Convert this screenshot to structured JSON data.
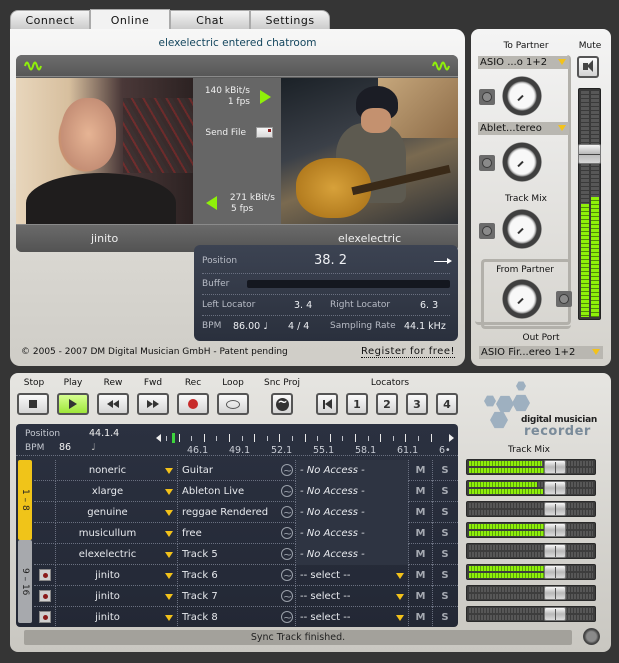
{
  "tabs": [
    {
      "label": "Connect",
      "active": false
    },
    {
      "label": "Online",
      "active": true
    },
    {
      "label": "Chat",
      "active": false
    },
    {
      "label": "Settings",
      "active": false
    }
  ],
  "online": {
    "chat_status": "elexelectric entered chatroom",
    "video": {
      "left_user": "jinito",
      "right_user": "elexelectric",
      "outgoing_rate": "140 kBit/s",
      "outgoing_fps": "1 fps",
      "send_file_label": "Send File",
      "incoming_rate": "271 kBit/s",
      "incoming_fps": "5 fps"
    },
    "status": {
      "position_label": "Position",
      "position_value": "38. 2",
      "buffer_label": "Buffer",
      "left_locator_label": "Left Locator",
      "left_locator_value": "3. 4",
      "right_locator_label": "Right Locator",
      "right_locator_value": "6. 3",
      "bpm_label": "BPM",
      "bpm_value": "86.00 ♩",
      "time_signature": "4 / 4",
      "sampling_rate_label": "Sampling Rate",
      "sampling_rate_value": "44.1 kHz"
    },
    "copyright": "© 2005 - 2007 DM Digital Musician GmbH - Patent pending",
    "register_link": "Register for free!"
  },
  "routing": {
    "to_partner_label": "To Partner",
    "mute_label": "Mute",
    "input1": "ASIO ...o 1+2",
    "input2": "Ablet...tereo",
    "track_mix_label": "Track Mix",
    "from_partner_label": "From Partner",
    "out_port_label": "Out Port",
    "out_port_value": "ASIO Fir...ereo 1+2",
    "master_level_left": 0.5,
    "master_level_right": 0.53,
    "master_fader": 0.74
  },
  "recorder": {
    "transport": {
      "stop": "Stop",
      "play": "Play",
      "rew": "Rew",
      "fwd": "Fwd",
      "rec": "Rec",
      "loop": "Loop",
      "sync_project": "Snc Proj",
      "locators": "Locators",
      "locator_buttons": [
        "1",
        "2",
        "3",
        "4"
      ]
    },
    "logo_line1": "digital musician",
    "logo_line2": "recorder",
    "track_mix_label": "Track Mix",
    "position_label": "Position",
    "position_value": "44.1.4",
    "bpm_label": "BPM",
    "bpm_value": "86",
    "note_symbol": "♩",
    "timeline_labels": [
      "46.1",
      "49.1",
      "52.1",
      "55.1",
      "58.1",
      "61.1",
      "6•"
    ],
    "banks": [
      "1 – 8",
      "9 – 16"
    ],
    "tracks": [
      {
        "user": "noneric",
        "name": "Guitar",
        "input": "- No Access -",
        "armed": false,
        "no_access": true,
        "mute": "M",
        "solo": "S",
        "mix_level": 0.64
      },
      {
        "user": "xlarge",
        "name": "Ableton Live",
        "input": "- No Access -",
        "armed": false,
        "no_access": true,
        "mute": "M",
        "solo": "S",
        "mix_level": 0.6
      },
      {
        "user": "genuine",
        "name": "reggae Rendered",
        "input": "- No Access -",
        "armed": false,
        "no_access": true,
        "mute": "M",
        "solo": "S",
        "mix_level": 0.0
      },
      {
        "user": "musicullum",
        "name": "free",
        "input": "- No Access -",
        "armed": false,
        "no_access": true,
        "mute": "M",
        "solo": "S",
        "mix_level": 0.75
      },
      {
        "user": "elexelectric",
        "name": "Track 5",
        "input": "- No Access -",
        "armed": false,
        "no_access": true,
        "mute": "M",
        "solo": "S",
        "mix_level": 0.0
      },
      {
        "user": "jinito",
        "name": "Track 6",
        "input": "-- select --",
        "armed": true,
        "no_access": false,
        "mute": "M",
        "solo": "S",
        "mix_level": 0.68
      },
      {
        "user": "jinito",
        "name": "Track 7",
        "input": "-- select --",
        "armed": true,
        "no_access": false,
        "mute": "M",
        "solo": "S",
        "mix_level": 0.0
      },
      {
        "user": "jinito",
        "name": "Track 8",
        "input": "-- select --",
        "armed": true,
        "no_access": false,
        "mute": "M",
        "solo": "S",
        "mix_level": 0.0
      }
    ],
    "status_message": "Sync Track finished."
  },
  "colors": {
    "accent_green": "#8ff00a",
    "dropdown_arrow": "#f3c21a",
    "bank_active": "#f0c419",
    "chat_text": "#14465e"
  }
}
